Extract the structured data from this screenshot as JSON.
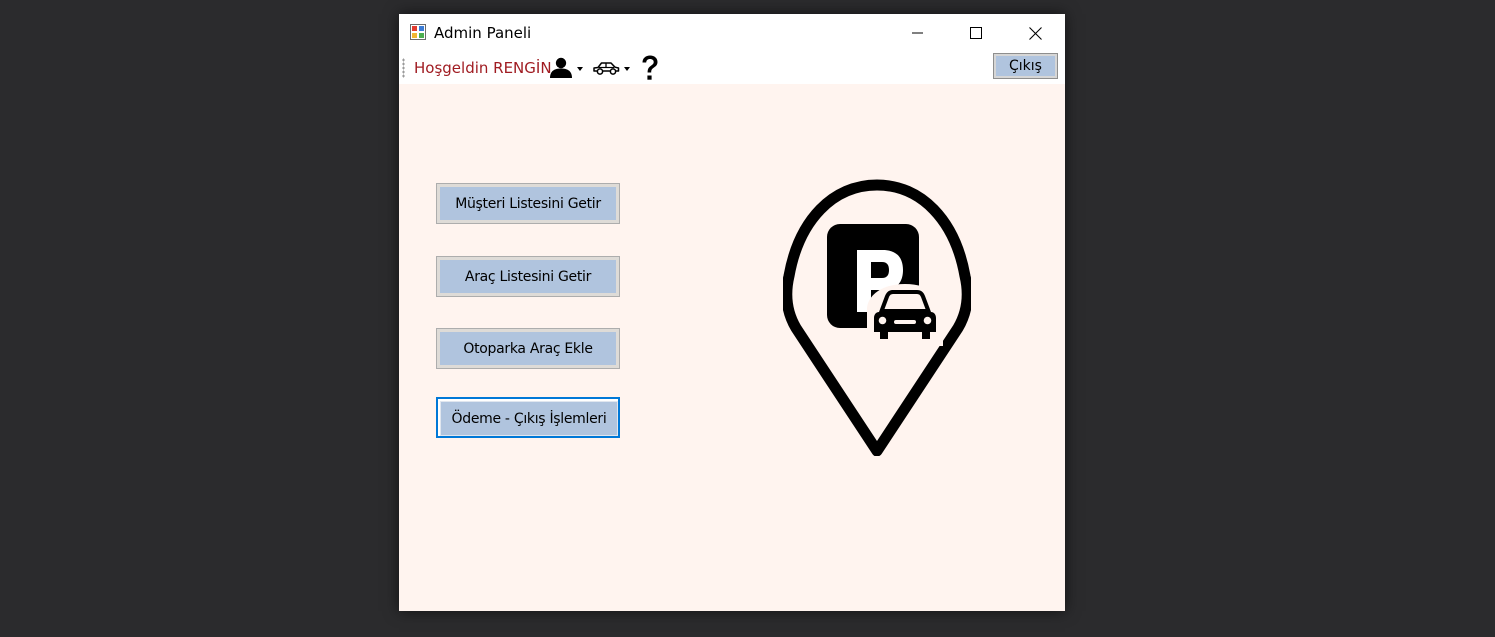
{
  "window": {
    "title": "Admin Paneli",
    "controls": {
      "minimize": "minimize-icon",
      "maximize": "maximize-icon",
      "close": "close-icon"
    }
  },
  "toolbar": {
    "welcome_text": "Hoşgeldin RENGİN",
    "welcome_color": "#a01c22",
    "user_menu_icon": "user-icon",
    "car_menu_icon": "car-icon",
    "help_icon": "question-mark-icon",
    "exit_label": "Çıkış"
  },
  "main": {
    "buttons": [
      {
        "label": "Müşteri Listesini Getir"
      },
      {
        "label": "Araç Listesini Getir"
      },
      {
        "label": "Otoparka Araç Ekle"
      },
      {
        "label": "Ödeme - Çıkış İşlemleri"
      }
    ],
    "logo_icon": "parking-location-pin-icon"
  },
  "colors": {
    "background": "#fff4ef",
    "button_fill": "#b0c4de",
    "focus_border": "#0078d7",
    "desktop": "#2b2b2d"
  }
}
